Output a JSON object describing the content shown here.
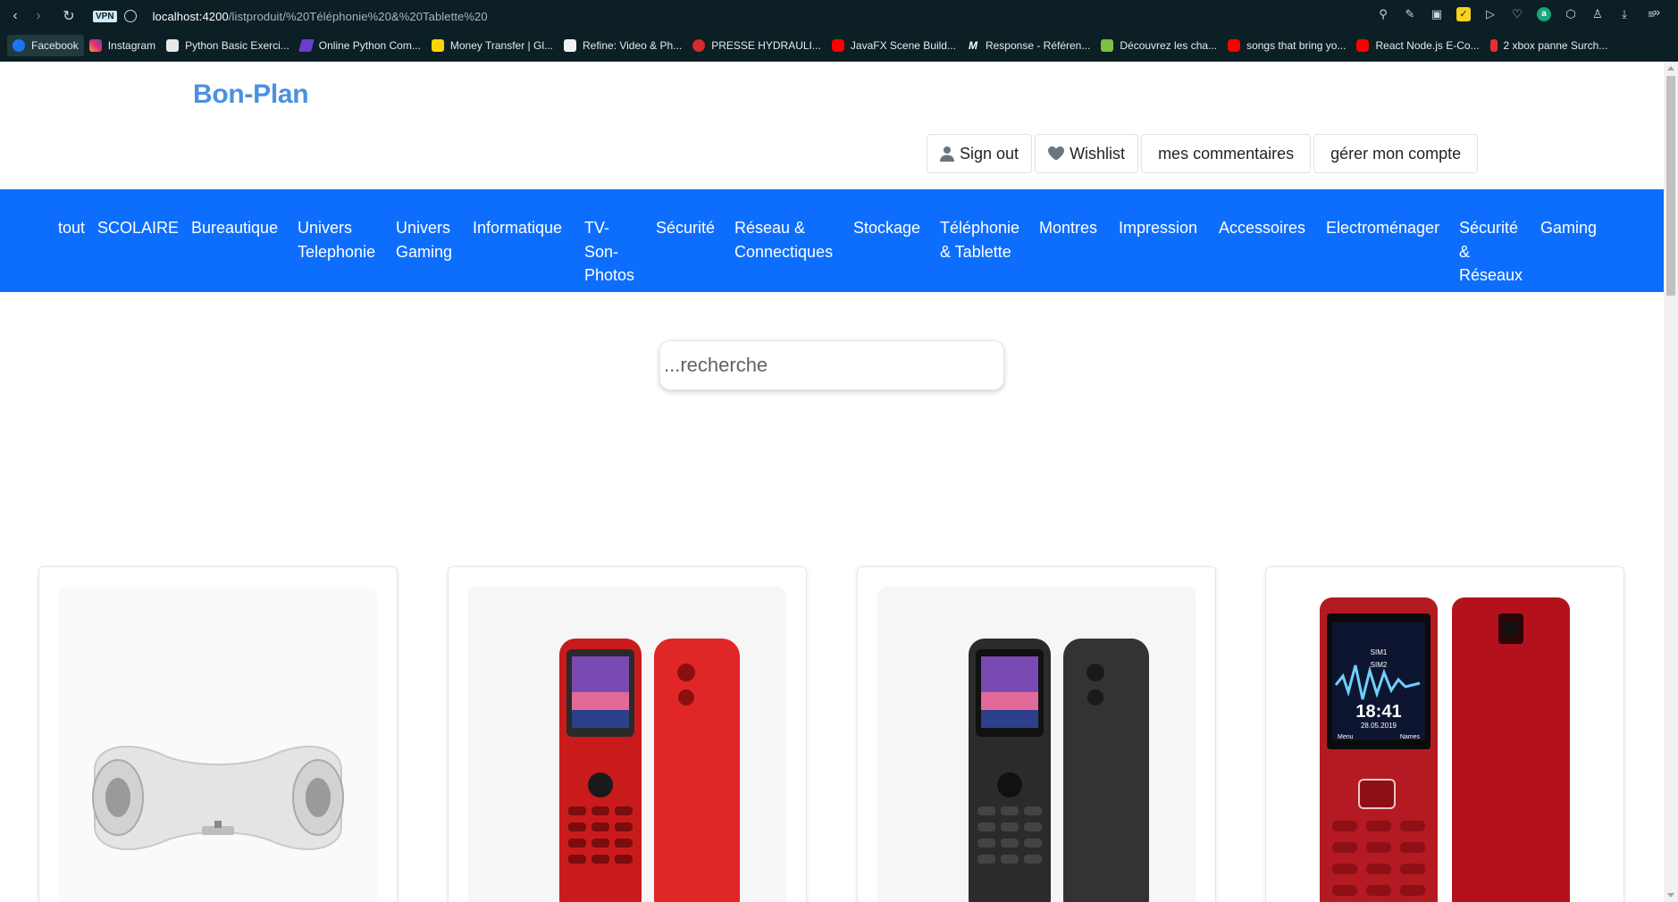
{
  "browser": {
    "url_host": "localhost:4200",
    "url_path": "/listproduit/%20Téléphonie%20&%20Tablette%20",
    "vpn_badge": "VPN",
    "bookmarks": [
      {
        "label": "Facebook",
        "icon": "facebook-icon"
      },
      {
        "label": "Instagram",
        "icon": "instagram-icon"
      },
      {
        "label": "Python Basic Exerci...",
        "icon": "python-icon"
      },
      {
        "label": "Online Python Com...",
        "icon": "online-python-icon"
      },
      {
        "label": "Money Transfer | Gl...",
        "icon": "western-union-icon"
      },
      {
        "label": "Refine: Video & Ph...",
        "icon": "document-icon"
      },
      {
        "label": "PRESSE HYDRAULI...",
        "icon": "press-icon"
      },
      {
        "label": "JavaFX Scene Build...",
        "icon": "youtube-icon"
      },
      {
        "label": "Response - Référen...",
        "icon": "m-icon"
      },
      {
        "label": "Découvrez les cha...",
        "icon": "green-icon"
      },
      {
        "label": "songs that bring yo...",
        "icon": "youtube-icon"
      },
      {
        "label": "React Node.js E-Co...",
        "icon": "youtube-icon"
      },
      {
        "label": "2 xbox panne Surch...",
        "icon": "tool-icon"
      }
    ]
  },
  "site": {
    "brand": "Bon-Plan",
    "account": {
      "sign_out": "Sign out",
      "wishlist": "Wishlist",
      "comments": "mes commentaires",
      "manage": "gérer mon compte"
    },
    "categories": [
      {
        "label": "tout"
      },
      {
        "label": "SCOLAIRE"
      },
      {
        "label": "Bureautique"
      },
      {
        "label": "Univers Telephonie"
      },
      {
        "label": "Univers Gaming"
      },
      {
        "label": "Informatique"
      },
      {
        "label": "TV-Son-Photos"
      },
      {
        "label": "Sécurité"
      },
      {
        "label": "Réseau & Connectiques"
      },
      {
        "label": "Stockage"
      },
      {
        "label": "Téléphonie & Tablette"
      },
      {
        "label": "Montres"
      },
      {
        "label": "Impression"
      },
      {
        "label": "Accessoires"
      },
      {
        "label": "Electroménager"
      },
      {
        "label": "Sécurité & Réseaux"
      },
      {
        "label": "Gaming"
      }
    ],
    "search": {
      "placeholder": "...recherche"
    },
    "phone_screen": {
      "clock": "18:41",
      "date": "28.05.2019",
      "sim1": "SIM1",
      "sim2": "SIM2",
      "left_soft": "Menu",
      "right_soft": "Names"
    }
  },
  "colors": {
    "brand": "#4a90e2",
    "nav_bg": "#0d6efd",
    "chrome_bg": "#0b1f24"
  }
}
